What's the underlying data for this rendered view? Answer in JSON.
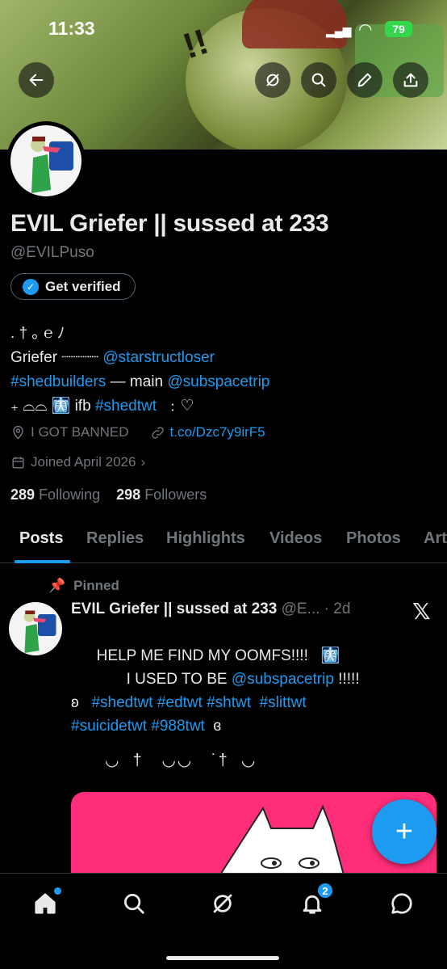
{
  "status_bar": {
    "time": "11:33",
    "battery": "79"
  },
  "header": {
    "back": "back",
    "grok": "grok",
    "search": "search",
    "edit": "edit",
    "share": "share"
  },
  "profile": {
    "display_name": "EVIL Griefer || sussed at 233",
    "handle": "@EVILPuso",
    "verify_label": "Get verified",
    "bio": {
      "line1": ". † ｡ ℮ ﾉ",
      "line2_text": "Griefer ┈┈┈┈ ",
      "line2_link": "@starstructloser",
      "line3_link1": "#shedbuilders",
      "line3_text": " — main ",
      "line3_link2": "@subspacetrip",
      "line4_text1": "₊ ⌓⌓ 🩻 ifb ",
      "line4_link": "#shedtwt",
      "line4_text2": "  ﹕♡"
    },
    "location": "I GOT BANNED",
    "url": "t.co/Dzc7y9irF5",
    "joined": "Joined April 2026",
    "following_count": "289",
    "following_label": "Following",
    "followers_count": "298",
    "followers_label": "Followers"
  },
  "tabs": [
    "Posts",
    "Replies",
    "Highlights",
    "Videos",
    "Photos",
    "Art"
  ],
  "post": {
    "pinned_label": "Pinned",
    "author": "EVIL Griefer || sussed at 233",
    "handle_time": " @E... · 2d",
    "line1": "      HELP ME FIND MY OOMFS!!!!   🩻",
    "line2a": "             I USED TO BE ",
    "line2_link": "@subspacetrip",
    "line2b": " !!!!!",
    "line3a": "ʚ   ",
    "line3_link": "#shedtwt #edtwt #shtwt  #slittwt",
    "line4_link": "#suicidetwt #988twt",
    "line4b": "  ɞ",
    "deco": "◡  †   ◡◡   ˙†  ◡"
  },
  "fab_label": "+",
  "bottom_nav": {
    "notifications_count": "2"
  },
  "colors": {
    "accent": "#1d9bf0",
    "background": "#000000",
    "muted": "#71767b",
    "media": "#ff2d7a"
  }
}
